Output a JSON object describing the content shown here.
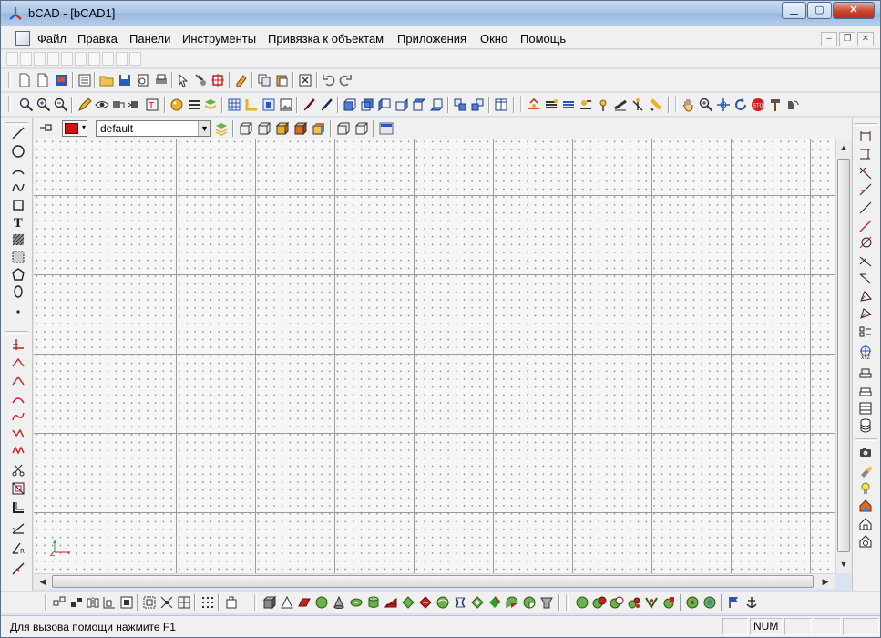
{
  "window": {
    "title": "bCAD - [bCAD1]"
  },
  "menu": {
    "items": [
      "Файл",
      "Правка",
      "Панели",
      "Инструменты",
      "Привязка к объектам",
      "Приложения",
      "Окно",
      "Помощь"
    ]
  },
  "layer_bar": {
    "layer_name": "default",
    "current_color": "#d61010"
  },
  "status": {
    "help_text": "Для вызова помощи нажмите F1",
    "num_indicator": "NUM"
  },
  "icons": {
    "standard": [
      "new-doc-icon",
      "new-doc2-icon",
      "template-icon",
      "list-icon",
      "open-folder-icon",
      "save-icon",
      "print-preview-icon",
      "print-icon",
      "select-arrow-icon",
      "move-icon",
      "transform-icon",
      "erase-icon",
      "copy-icon",
      "paste-icon",
      "properties-icon",
      "undo-icon",
      "redo-icon"
    ],
    "view": [
      "zoom-window-icon",
      "zoom-in-icon",
      "zoom-out-icon",
      "pen-icon",
      "eye-icon",
      "hide-icon",
      "show-icon",
      "text-icon",
      "render-icon",
      "layers-icon",
      "stack-icon",
      "grid-icon",
      "snap-icon",
      "grid-cell-icon",
      "image-icon",
      "brush-icon",
      "paint-icon",
      "view-front-icon",
      "view-back-icon",
      "view-left-icon",
      "view-right-icon",
      "view-top-icon",
      "view-bottom-icon",
      "view-iso-icon",
      "view-iso2-icon",
      "window-split-icon",
      "lamp-icon",
      "light-icon",
      "layers-light-icon",
      "spot-icon",
      "sun-icon",
      "material-icon",
      "stripe-icon",
      "pan-hand-icon",
      "zoom-icon",
      "move-view-icon",
      "rotate-view-icon",
      "stop-icon",
      "hammer-icon",
      "camera-rotate-icon"
    ],
    "draw_left": [
      "line-icon",
      "circle-icon",
      "arc-icon",
      "spline-icon",
      "rectangle-icon",
      "text-tool-icon",
      "hatch-icon",
      "region-icon",
      "polygon-icon",
      "ellipse-icon",
      "point-icon"
    ],
    "edit_left": [
      "trim-icon",
      "chamfer-icon",
      "fillet-icon",
      "curve-icon",
      "bezier-icon",
      "wave-icon",
      "zigzag-icon",
      "scissors-icon",
      "offset-icon",
      "corner-icon",
      "angle-icon",
      "angle-r-icon",
      "break-icon"
    ],
    "dim_right": [
      "dim-h-icon",
      "dim-v-icon",
      "dim-angle-icon",
      "dim-aligned-icon",
      "dim-aligned2-icon",
      "dim-line-icon",
      "dim-diameter-icon",
      "dim-arrow-icon",
      "dim-arrow2-icon",
      "dim-radius-icon",
      "dim-radius2-icon",
      "dim-table-icon",
      "ucs-icon",
      "stack1-icon",
      "stack2-icon",
      "stack3-icon",
      "database-icon",
      "camera-icon",
      "flashlight-icon",
      "bulb-icon",
      "house-icon",
      "house2-icon",
      "house3-icon"
    ],
    "solids_bottom": [
      "ucs-bottom-icon",
      "array-icon",
      "mirror-icon",
      "align-icon",
      "block-icon",
      "group-icon",
      "ungroup-icon",
      "explode-icon",
      "grid-dots-icon",
      "insert-icon",
      "box-icon",
      "pyramid-icon",
      "plane-icon",
      "sphere-icon",
      "cone-icon",
      "torus-icon",
      "cylinder-icon",
      "wedge-icon",
      "extrude-icon",
      "revolve-icon",
      "sweep-icon",
      "loft-icon",
      "shell-icon",
      "fillet3d-icon",
      "cut-icon",
      "slice-icon",
      "union-icon",
      "subtract-icon",
      "intersect-icon",
      "section-icon",
      "interference-icon",
      "boolean1-icon",
      "boolean2-icon",
      "flag-icon",
      "anchor-icon"
    ]
  }
}
